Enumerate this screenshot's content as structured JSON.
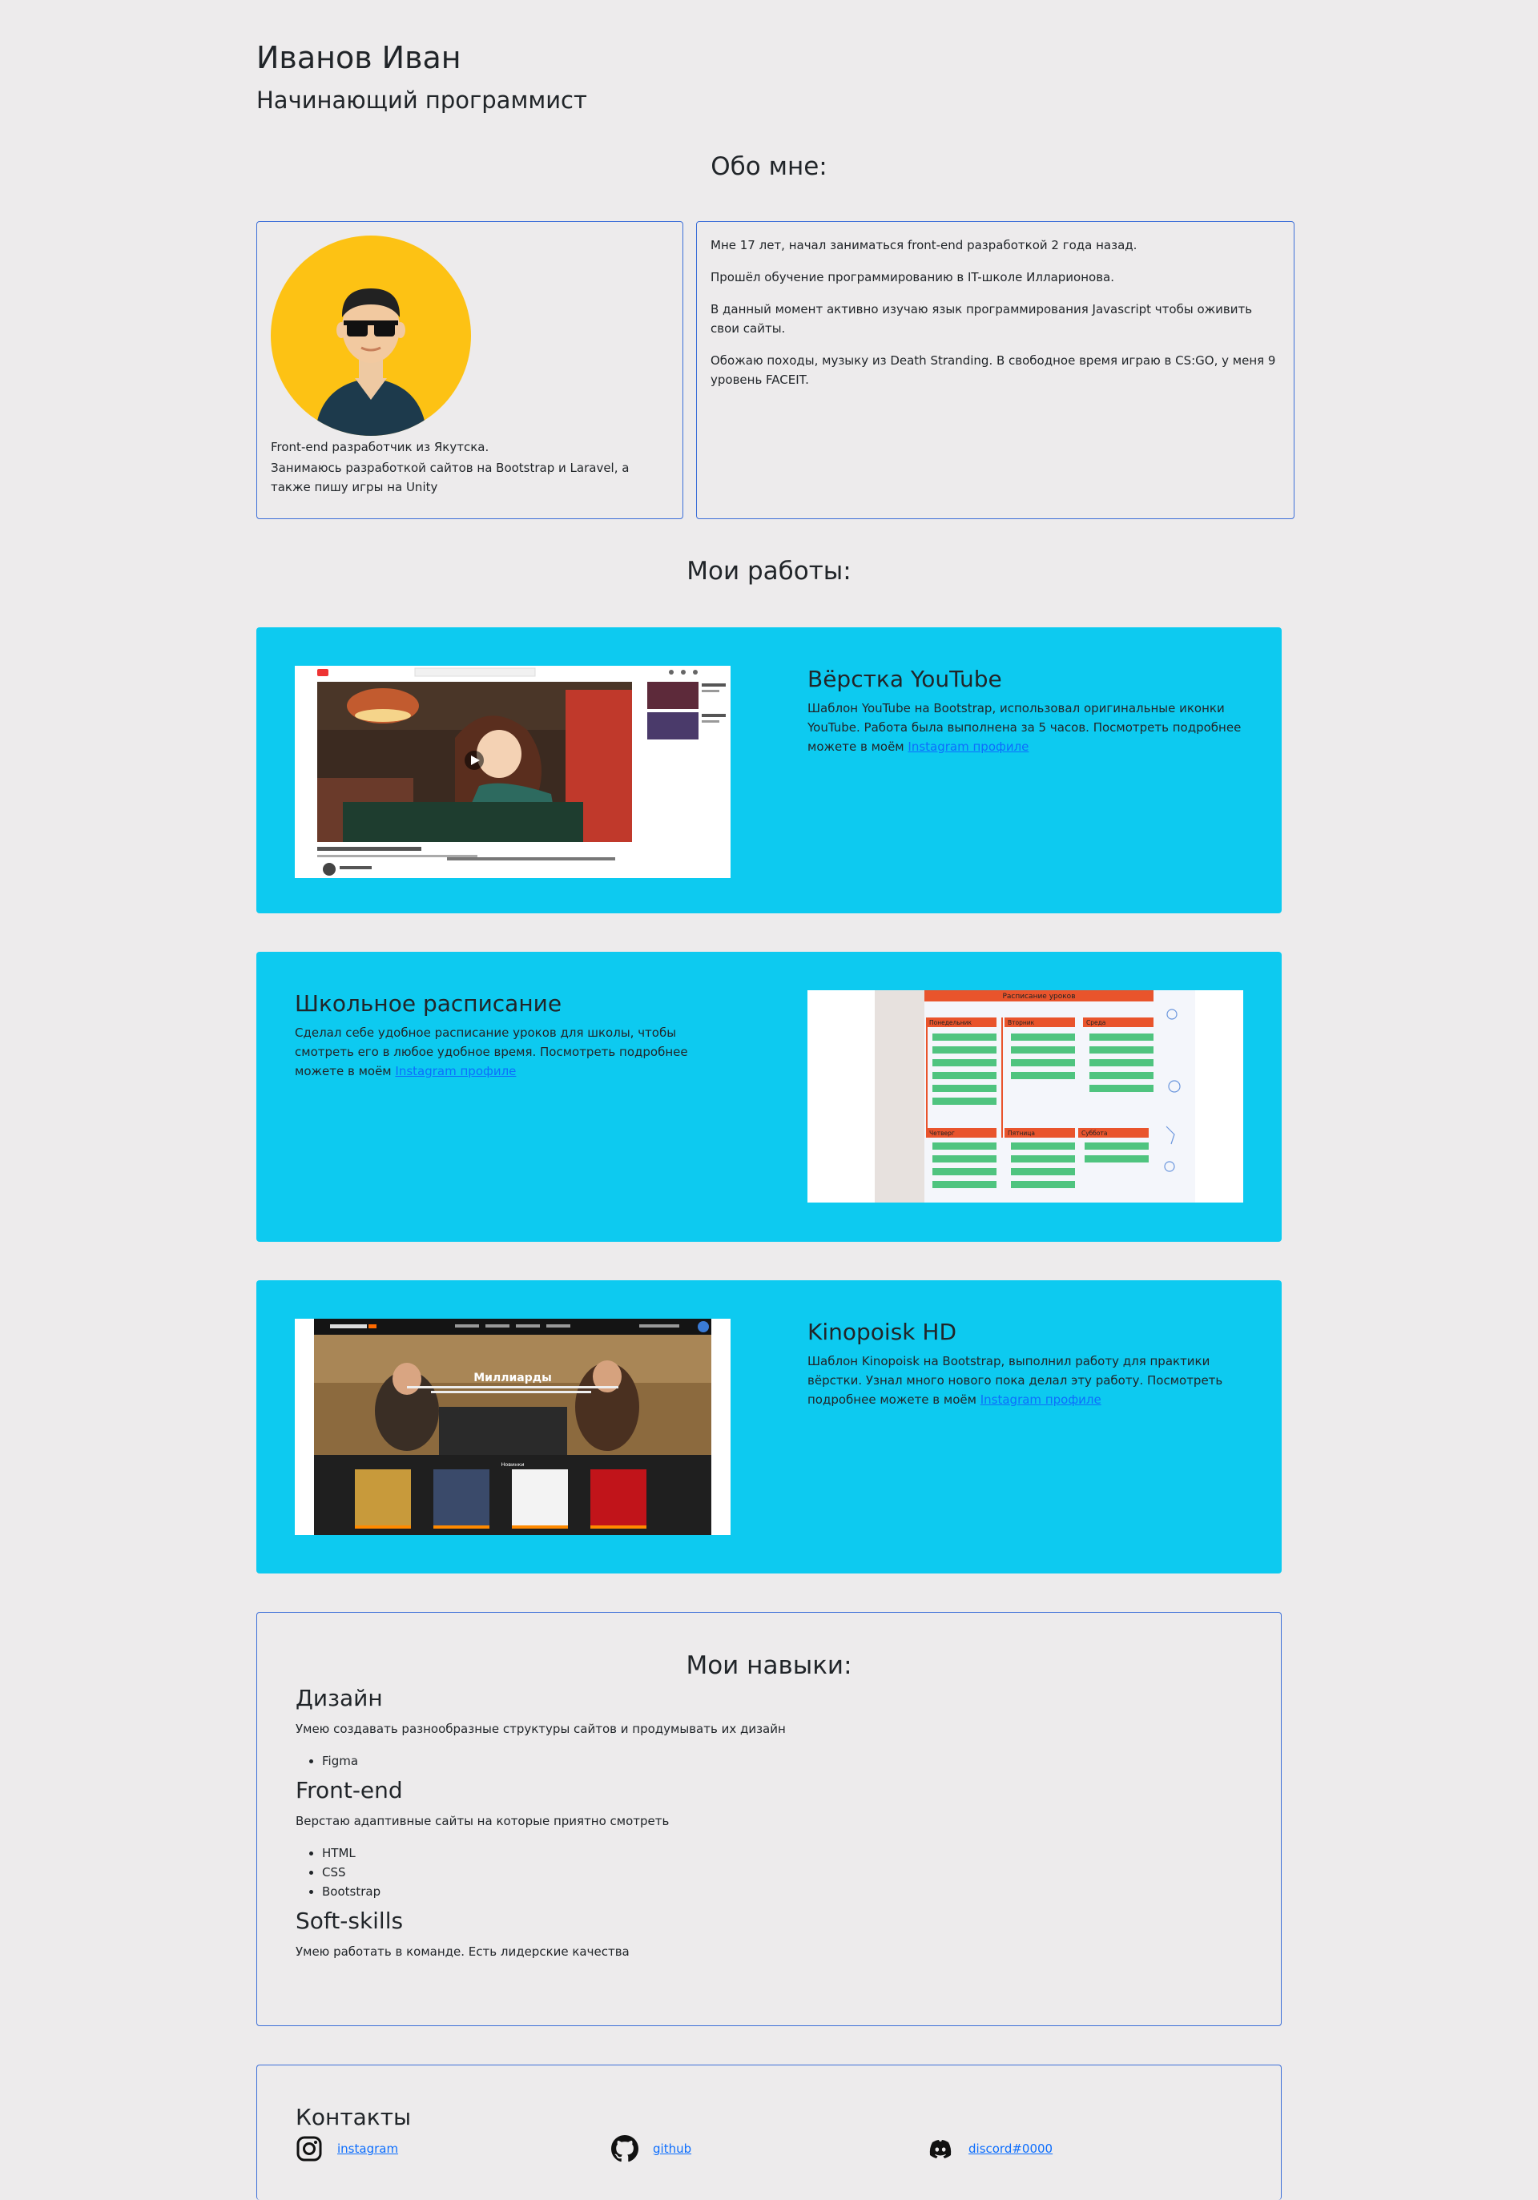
{
  "header": {
    "name": "Иванов Иван",
    "role": "Начинающий программист"
  },
  "about": {
    "title": "Обо мне:",
    "left_text_1": "Front-end разработчик из Якутска.",
    "left_text_2": "Занимаюсь разработкой сайтов на Bootstrap и Laravel, а также пишу игры на Unity",
    "paragraphs": [
      "Мне 17 лет, начал заниматься front-end разработкой 2 года назад.",
      "Прошёл обучение программированию в IT-школе Илларионова.",
      "В данный момент активно изучаю язык программирования Javascript чтобы оживить свои сайты.",
      "Обожаю походы, музыку из Death Stranding. В свободное время играю в CS:GO, у меня 9 уровень FACEIT."
    ]
  },
  "works": {
    "title": "Мои работы:",
    "items": [
      {
        "title": "Вёрстка YouTube",
        "text": "Шаблон YouTube на Bootstrap, использовал оригинальные иконки YouTube. Работа была выполнена за 5 часов. Посмотреть подробнее можете в моём",
        "link": "Instagram профиле"
      },
      {
        "title": "Школьное расписание",
        "text": "Сделал себе удобное расписание уроков для школы, чтобы смотреть его в любое удобное время. Посмотреть подробнее можете в моём",
        "link": "Instagram профиле",
        "shot_header": "Расписание уроков",
        "shot_days_top": [
          "Понедельник",
          "Вторник",
          "Среда"
        ],
        "shot_days_bottom": [
          "Четверг",
          "Пятница",
          "Суббота"
        ]
      },
      {
        "title": "Kinopoisk HD",
        "text": "Шаблон Kinopoisk на Bootstrap, выполнил работу для практики вёрстки. Узнал много нового пока делал эту работу. Посмотреть подробнее можете в моём",
        "link": "Instagram профиле",
        "shot_hero_title": "Миллиарды",
        "shot_section": "Новинки"
      }
    ]
  },
  "skills": {
    "title": "Мои навыки:",
    "groups": [
      {
        "title": "Дизайн",
        "text": "Умею создавать разнообразные структуры сайтов и продумывать их дизайн",
        "items": [
          "Figma"
        ]
      },
      {
        "title": "Front-end",
        "text": "Верстаю адаптивные сайты на которые приятно смотреть",
        "items": [
          "HTML",
          "CSS",
          "Bootstrap"
        ]
      },
      {
        "title": "Soft-skills",
        "text": "Умею работать в команде. Есть лидерские качества",
        "items": []
      }
    ]
  },
  "contacts": {
    "title": "Контакты",
    "items": [
      {
        "label": "instagram",
        "icon": "instagram-icon"
      },
      {
        "label": "github",
        "icon": "github-icon"
      },
      {
        "label": "discord#0000",
        "icon": "discord-icon"
      }
    ]
  },
  "colors": {
    "background": "#edebec",
    "card": "#0dcaf0",
    "border": "#3d6fd8",
    "link": "#0d6efd",
    "avatar_bg": "#fdc214"
  }
}
